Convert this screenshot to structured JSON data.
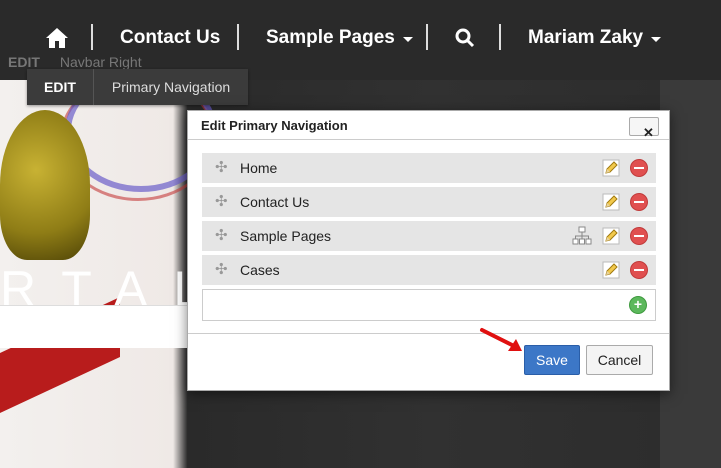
{
  "navbar": {
    "home_icon": "home-icon",
    "items": [
      {
        "label": "Contact Us"
      },
      {
        "label": "Sample Pages"
      },
      {
        "label": "Mariam Zaky"
      }
    ],
    "search_icon": "search-icon"
  },
  "edit_ghost": {
    "edit": "EDIT",
    "label": "Navbar Right"
  },
  "edit_bar": {
    "edit": "EDIT",
    "label": "Primary Navigation"
  },
  "hero": {
    "word": "RTAL"
  },
  "dialog": {
    "title": "Edit Primary Navigation",
    "close_label": "✕",
    "items": [
      {
        "label": "Home"
      },
      {
        "label": "Contact Us"
      },
      {
        "label": "Sample Pages"
      },
      {
        "label": "Cases"
      }
    ],
    "save_label": "Save",
    "cancel_label": "Cancel"
  },
  "colors": {
    "save": "#3c77c7",
    "remove": "#e05050",
    "add": "#5cb85c",
    "annotation_arrow": "#e01010"
  }
}
